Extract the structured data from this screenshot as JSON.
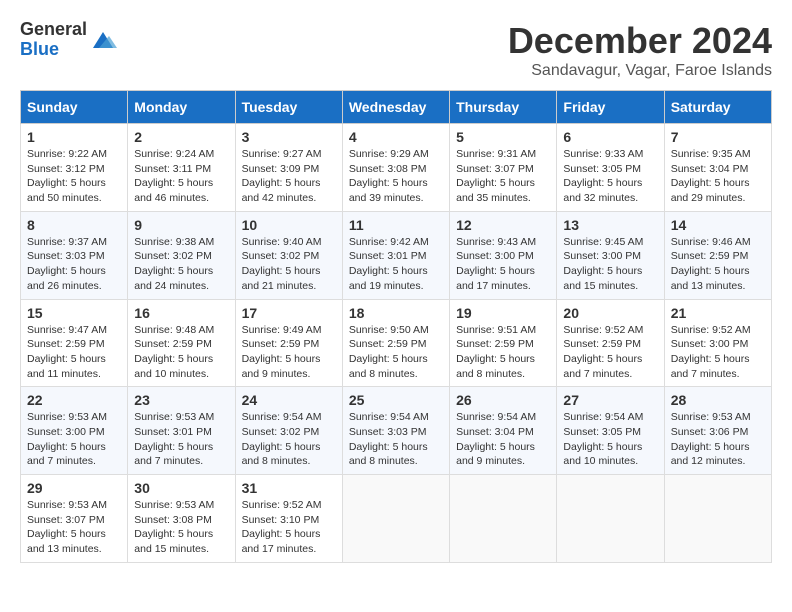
{
  "logo": {
    "general": "General",
    "blue": "Blue"
  },
  "title": "December 2024",
  "subtitle": "Sandavagur, Vagar, Faroe Islands",
  "headers": [
    "Sunday",
    "Monday",
    "Tuesday",
    "Wednesday",
    "Thursday",
    "Friday",
    "Saturday"
  ],
  "weeks": [
    [
      {
        "day": "1",
        "sunrise": "9:22 AM",
        "sunset": "3:12 PM",
        "daylight": "5 hours and 50 minutes."
      },
      {
        "day": "2",
        "sunrise": "9:24 AM",
        "sunset": "3:11 PM",
        "daylight": "5 hours and 46 minutes."
      },
      {
        "day": "3",
        "sunrise": "9:27 AM",
        "sunset": "3:09 PM",
        "daylight": "5 hours and 42 minutes."
      },
      {
        "day": "4",
        "sunrise": "9:29 AM",
        "sunset": "3:08 PM",
        "daylight": "5 hours and 39 minutes."
      },
      {
        "day": "5",
        "sunrise": "9:31 AM",
        "sunset": "3:07 PM",
        "daylight": "5 hours and 35 minutes."
      },
      {
        "day": "6",
        "sunrise": "9:33 AM",
        "sunset": "3:05 PM",
        "daylight": "5 hours and 32 minutes."
      },
      {
        "day": "7",
        "sunrise": "9:35 AM",
        "sunset": "3:04 PM",
        "daylight": "5 hours and 29 minutes."
      }
    ],
    [
      {
        "day": "8",
        "sunrise": "9:37 AM",
        "sunset": "3:03 PM",
        "daylight": "5 hours and 26 minutes."
      },
      {
        "day": "9",
        "sunrise": "9:38 AM",
        "sunset": "3:02 PM",
        "daylight": "5 hours and 24 minutes."
      },
      {
        "day": "10",
        "sunrise": "9:40 AM",
        "sunset": "3:02 PM",
        "daylight": "5 hours and 21 minutes."
      },
      {
        "day": "11",
        "sunrise": "9:42 AM",
        "sunset": "3:01 PM",
        "daylight": "5 hours and 19 minutes."
      },
      {
        "day": "12",
        "sunrise": "9:43 AM",
        "sunset": "3:00 PM",
        "daylight": "5 hours and 17 minutes."
      },
      {
        "day": "13",
        "sunrise": "9:45 AM",
        "sunset": "3:00 PM",
        "daylight": "5 hours and 15 minutes."
      },
      {
        "day": "14",
        "sunrise": "9:46 AM",
        "sunset": "2:59 PM",
        "daylight": "5 hours and 13 minutes."
      }
    ],
    [
      {
        "day": "15",
        "sunrise": "9:47 AM",
        "sunset": "2:59 PM",
        "daylight": "5 hours and 11 minutes."
      },
      {
        "day": "16",
        "sunrise": "9:48 AM",
        "sunset": "2:59 PM",
        "daylight": "5 hours and 10 minutes."
      },
      {
        "day": "17",
        "sunrise": "9:49 AM",
        "sunset": "2:59 PM",
        "daylight": "5 hours and 9 minutes."
      },
      {
        "day": "18",
        "sunrise": "9:50 AM",
        "sunset": "2:59 PM",
        "daylight": "5 hours and 8 minutes."
      },
      {
        "day": "19",
        "sunrise": "9:51 AM",
        "sunset": "2:59 PM",
        "daylight": "5 hours and 8 minutes."
      },
      {
        "day": "20",
        "sunrise": "9:52 AM",
        "sunset": "2:59 PM",
        "daylight": "5 hours and 7 minutes."
      },
      {
        "day": "21",
        "sunrise": "9:52 AM",
        "sunset": "3:00 PM",
        "daylight": "5 hours and 7 minutes."
      }
    ],
    [
      {
        "day": "22",
        "sunrise": "9:53 AM",
        "sunset": "3:00 PM",
        "daylight": "5 hours and 7 minutes."
      },
      {
        "day": "23",
        "sunrise": "9:53 AM",
        "sunset": "3:01 PM",
        "daylight": "5 hours and 7 minutes."
      },
      {
        "day": "24",
        "sunrise": "9:54 AM",
        "sunset": "3:02 PM",
        "daylight": "5 hours and 8 minutes."
      },
      {
        "day": "25",
        "sunrise": "9:54 AM",
        "sunset": "3:03 PM",
        "daylight": "5 hours and 8 minutes."
      },
      {
        "day": "26",
        "sunrise": "9:54 AM",
        "sunset": "3:04 PM",
        "daylight": "5 hours and 9 minutes."
      },
      {
        "day": "27",
        "sunrise": "9:54 AM",
        "sunset": "3:05 PM",
        "daylight": "5 hours and 10 minutes."
      },
      {
        "day": "28",
        "sunrise": "9:53 AM",
        "sunset": "3:06 PM",
        "daylight": "5 hours and 12 minutes."
      }
    ],
    [
      {
        "day": "29",
        "sunrise": "9:53 AM",
        "sunset": "3:07 PM",
        "daylight": "5 hours and 13 minutes."
      },
      {
        "day": "30",
        "sunrise": "9:53 AM",
        "sunset": "3:08 PM",
        "daylight": "5 hours and 15 minutes."
      },
      {
        "day": "31",
        "sunrise": "9:52 AM",
        "sunset": "3:10 PM",
        "daylight": "5 hours and 17 minutes."
      },
      null,
      null,
      null,
      null
    ]
  ]
}
